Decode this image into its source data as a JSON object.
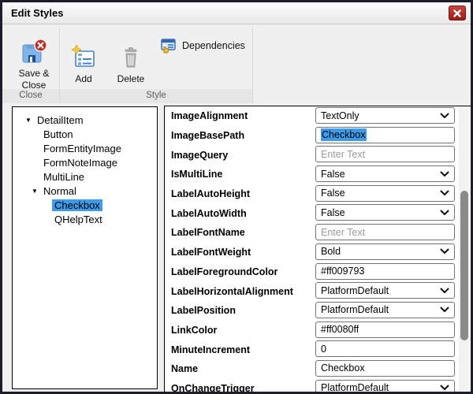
{
  "window": {
    "title": "Edit Styles"
  },
  "toolbar": {
    "buttons": [
      {
        "label": "Save & Close",
        "icon": "save-close-icon"
      },
      {
        "label": "Add",
        "icon": "add-icon"
      },
      {
        "label": "Delete",
        "icon": "delete-icon"
      },
      {
        "label": "Dependencies",
        "icon": "dependencies-icon"
      }
    ],
    "groups": [
      {
        "label": "Close"
      },
      {
        "label": "Style"
      }
    ]
  },
  "tree": {
    "items": [
      {
        "label": "DetailItem",
        "level": 0,
        "expanded": true
      },
      {
        "label": "Button",
        "level": 1
      },
      {
        "label": "FormEntityImage",
        "level": 1
      },
      {
        "label": "FormNoteImage",
        "level": 1
      },
      {
        "label": "MultiLine",
        "level": 1
      },
      {
        "label": "Normal",
        "level": 1,
        "expanded": true
      },
      {
        "label": "Checkbox",
        "level": 2,
        "selected": true
      },
      {
        "label": "QHelpText",
        "level": 2
      }
    ]
  },
  "properties": {
    "rows": [
      {
        "name": "ImageAlignment",
        "type": "select",
        "value": "TextOnly"
      },
      {
        "name": "ImageBasePath",
        "type": "text",
        "value": "Checkbox",
        "selected": true
      },
      {
        "name": "ImageQuery",
        "type": "text",
        "value": "",
        "placeholder": "Enter Text"
      },
      {
        "name": "IsMultiLine",
        "type": "select",
        "value": "False"
      },
      {
        "name": "LabelAutoHeight",
        "type": "select",
        "value": "False"
      },
      {
        "name": "LabelAutoWidth",
        "type": "select",
        "value": "False"
      },
      {
        "name": "LabelFontName",
        "type": "text",
        "value": "",
        "placeholder": "Enter Text"
      },
      {
        "name": "LabelFontWeight",
        "type": "select",
        "value": "Bold"
      },
      {
        "name": "LabelForegroundColor",
        "type": "text",
        "value": "#ff009793"
      },
      {
        "name": "LabelHorizontalAlignment",
        "type": "select",
        "value": "PlatformDefault"
      },
      {
        "name": "LabelPosition",
        "type": "select",
        "value": "PlatformDefault"
      },
      {
        "name": "LinkColor",
        "type": "text",
        "value": "#ff0080ff"
      },
      {
        "name": "MinuteIncrement",
        "type": "text",
        "value": "0"
      },
      {
        "name": "Name",
        "type": "text",
        "value": "Checkbox"
      },
      {
        "name": "OnChangeTrigger",
        "type": "select",
        "value": "PlatformDefault"
      }
    ]
  },
  "colors": {
    "selection_blue": "#3e9be9",
    "close_button_red": "#a92420",
    "window_border": "#1d1d2b",
    "ribbon_bg": "#f0f0f0"
  }
}
